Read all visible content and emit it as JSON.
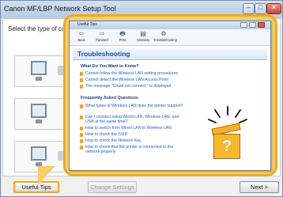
{
  "window": {
    "title": "Canon MF/LBP Network Setup Tool",
    "instruction": "Select the type of conne"
  },
  "buttons": {
    "useful_tips": "Useful Tips",
    "change_settings": "Change Settings",
    "next": "Next >"
  },
  "help_window": {
    "title": "Useful Tips",
    "toolbar": [
      {
        "label": "Back",
        "icon": "back-arrow-icon",
        "glyph": "⇦"
      },
      {
        "label": "Forward",
        "icon": "forward-arrow-icon",
        "glyph": "⇨"
      },
      {
        "label": "Print",
        "icon": "printer-icon",
        "glyph": "🖶"
      },
      {
        "label": "Glossary",
        "icon": "glossary-icon",
        "glyph": "▤"
      },
      {
        "label": "Troubleshooting",
        "icon": "troubleshooting-icon",
        "glyph": "⚙"
      }
    ],
    "heading": "Troubleshooting",
    "section1": {
      "title": "What Do You Want to Know?",
      "links": [
        "Cannot follow the Wireless LAN setting procedures",
        "Cannot detect the Wireless LAN Access Point",
        "The message \"Could not connect.\" is displayed"
      ]
    },
    "section2": {
      "title": "Frequently Asked Questions",
      "links": [
        "What types of Wireless LAN does the printer support?",
        "Can I connect using Wired LAN, Wireless LAN, and USB at the same time?",
        "How to switch from Wired LAN to Wireless LAN",
        "How to check the SSID",
        "How to check the Network Key",
        "How to check that the printer is connected to the network properly"
      ]
    }
  },
  "colors": {
    "callout_fill": "#f7cf68",
    "callout_border": "#eba928",
    "heading_text": "#1d4f91",
    "link_text": "#1f5fbf"
  }
}
